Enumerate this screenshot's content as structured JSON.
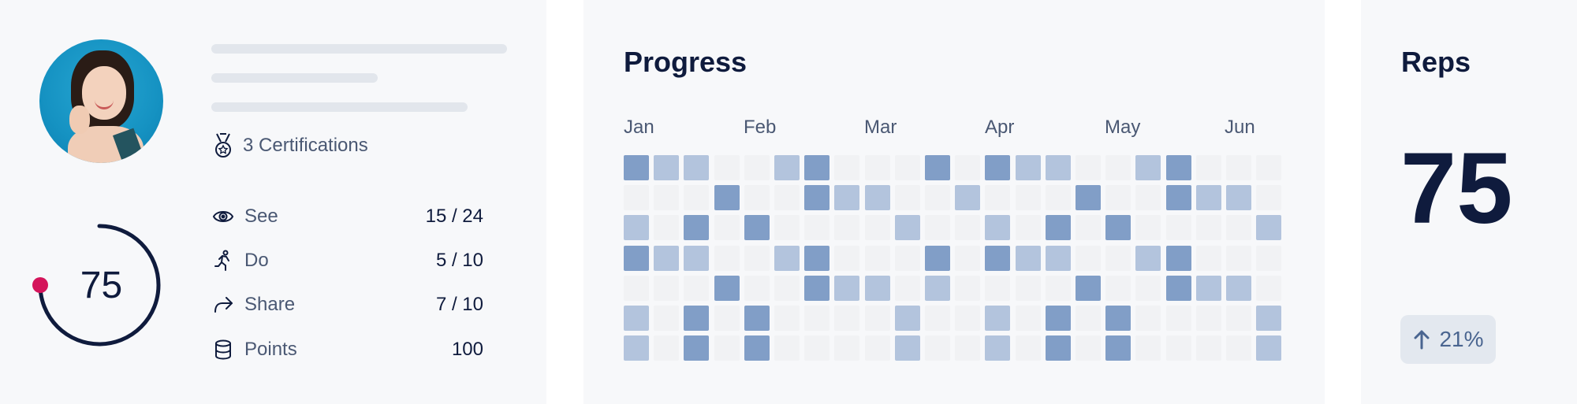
{
  "profile": {
    "certifications_label": "3 Certifications",
    "score": "75",
    "score_fraction": 0.75,
    "stats": [
      {
        "icon": "eye-icon",
        "label": "See",
        "value": "15 / 24"
      },
      {
        "icon": "running-icon",
        "label": "Do",
        "value": "5 / 10"
      },
      {
        "icon": "share-icon",
        "label": "Share",
        "value": "7 / 10"
      },
      {
        "icon": "database-icon",
        "label": "Points",
        "value": "100"
      }
    ]
  },
  "progress": {
    "title": "Progress",
    "months": [
      "Jan",
      "Feb",
      "Mar",
      "Apr",
      "May",
      "Jun"
    ],
    "levels": [
      [
        2,
        1,
        1,
        0,
        0,
        1,
        2,
        0,
        0,
        0,
        2,
        0,
        2,
        1,
        1,
        0,
        0,
        1,
        2,
        0,
        0,
        0
      ],
      [
        0,
        0,
        0,
        2,
        0,
        0,
        2,
        1,
        1,
        0,
        0,
        1,
        0,
        0,
        0,
        2,
        0,
        0,
        2,
        1,
        1,
        0
      ],
      [
        1,
        0,
        2,
        0,
        2,
        0,
        0,
        0,
        0,
        1,
        0,
        0,
        1,
        0,
        2,
        0,
        2,
        0,
        0,
        0,
        0,
        1
      ],
      [
        2,
        1,
        1,
        0,
        0,
        1,
        2,
        0,
        0,
        0,
        2,
        0,
        2,
        1,
        1,
        0,
        0,
        1,
        2,
        0,
        0,
        0
      ],
      [
        0,
        0,
        0,
        2,
        0,
        0,
        2,
        1,
        1,
        0,
        1,
        0,
        0,
        0,
        0,
        2,
        0,
        0,
        2,
        1,
        1,
        0
      ],
      [
        1,
        0,
        2,
        0,
        2,
        0,
        0,
        0,
        0,
        1,
        0,
        0,
        1,
        0,
        2,
        0,
        2,
        0,
        0,
        0,
        0,
        1
      ],
      [
        1,
        0,
        2,
        0,
        2,
        0,
        0,
        0,
        0,
        1,
        0,
        0,
        1,
        0,
        2,
        0,
        2,
        0,
        0,
        0,
        0,
        1
      ]
    ]
  },
  "reps": {
    "title": "Reps",
    "value": "75",
    "trend": "21%"
  },
  "colors": {
    "level0": "#f1f2f4",
    "level1": "#b3c4dd",
    "level2": "#819ec7",
    "accent_dot": "#d4145a",
    "ring": "#0f1b3d"
  }
}
